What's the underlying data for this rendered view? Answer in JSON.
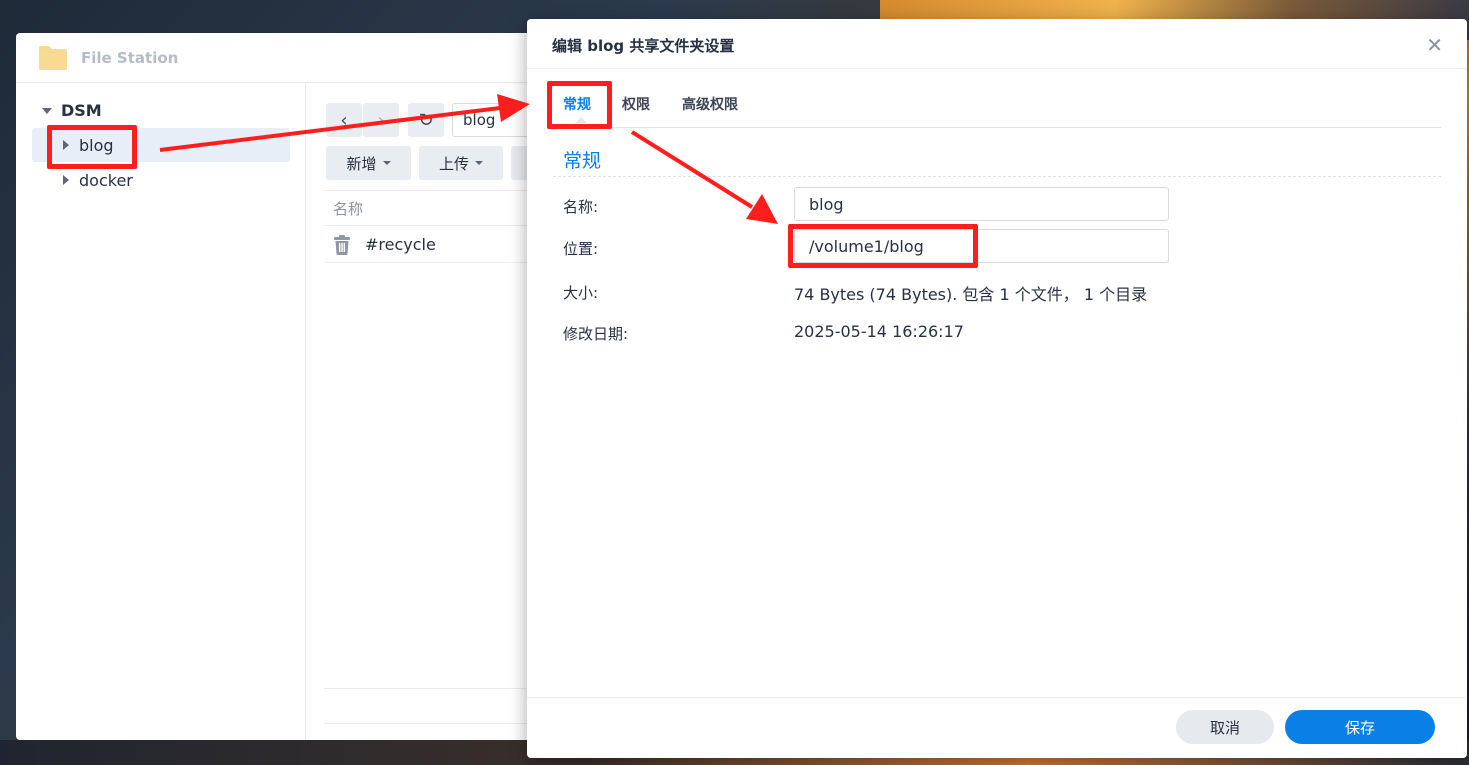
{
  "file_station": {
    "title": "File Station",
    "tree": {
      "root": "DSM",
      "items": [
        {
          "label": "blog",
          "selected": true
        },
        {
          "label": "docker",
          "selected": false
        }
      ]
    },
    "path_value": "blog",
    "toolbar": {
      "new_label": "新增",
      "upload_label": "上传"
    },
    "columns": {
      "name": "名称"
    },
    "files": [
      {
        "name": "#recycle",
        "icon": "trash-icon"
      }
    ]
  },
  "dialog": {
    "title": "编辑 blog 共享文件夹设置",
    "tabs": [
      {
        "label": "常规",
        "active": true
      },
      {
        "label": "权限",
        "active": false
      },
      {
        "label": "高级权限",
        "active": false
      }
    ],
    "section_title": "常规",
    "fields": {
      "name_label": "名称:",
      "name_value": "blog",
      "location_label": "位置:",
      "location_value": "/volume1/blog",
      "size_label": "大小:",
      "size_value": "74 Bytes (74 Bytes). 包含 1 个文件， 1 个目录",
      "date_label": "修改日期:",
      "date_value": "2025-05-14 16:26:17"
    },
    "buttons": {
      "cancel_label": "取消",
      "save_label": "保存"
    }
  },
  "colors": {
    "accent": "#057feb",
    "annotation": "#ff1e1e"
  }
}
